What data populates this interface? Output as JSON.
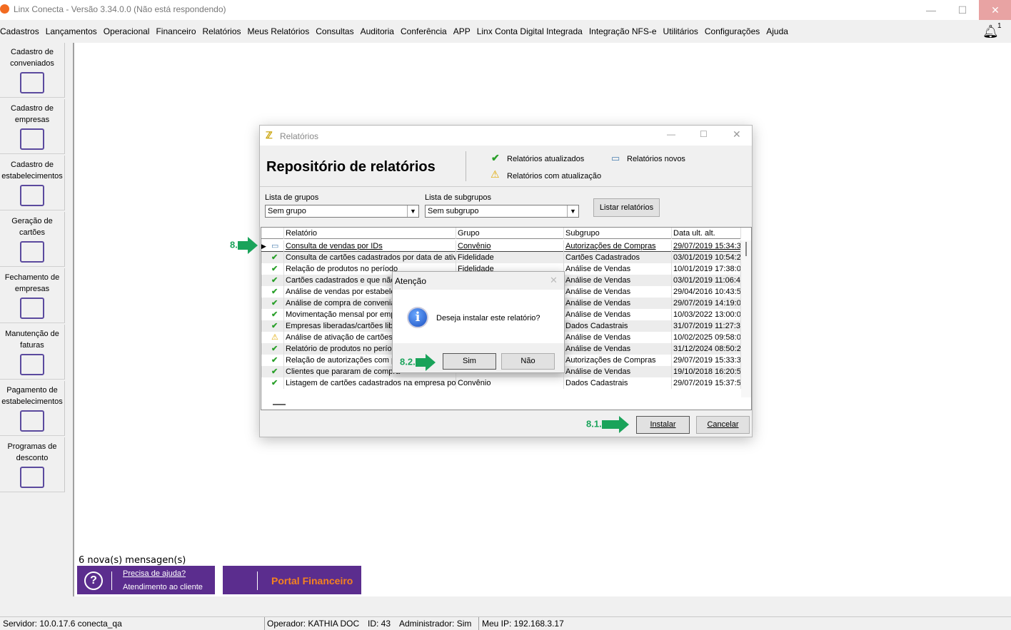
{
  "window": {
    "title": "Linx Conecta - Versão 3.34.0.0 (Não está respondendo)",
    "minimize": "—",
    "maximize": "☐",
    "close": "✕"
  },
  "menu": [
    "Cadastros",
    "Lançamentos",
    "Operacional",
    "Financeiro",
    "Relatórios",
    "Meus Relatórios",
    "Consultas",
    "Auditoria",
    "Conferência",
    "APP",
    "Linx Conta Digital Integrada",
    "Integração NFS-e",
    "Utilitários",
    "Configurações",
    "Ajuda"
  ],
  "notifications": {
    "count": "1"
  },
  "sidebar": [
    {
      "label": "Cadastro de conveniados",
      "icon": "user-icon"
    },
    {
      "label": "Cadastro de empresas",
      "icon": "building-icon"
    },
    {
      "label": "Cadastro de estabelecimentos",
      "icon": "store-icon"
    },
    {
      "label": "Geração de cartões",
      "icon": "card-icon"
    },
    {
      "label": "Fechamento de empresas",
      "icon": "invoice-icon"
    },
    {
      "label": "Manutenção de faturas",
      "icon": "tray-icon"
    },
    {
      "label": "Pagamento de estabelecimentos",
      "icon": "payment-icon"
    },
    {
      "label": "Programas de desconto",
      "icon": "discount-icon"
    }
  ],
  "messages": "6 nova(s) mensagen(s)",
  "help": {
    "link": "Precisa de ajuda?",
    "sub": "Atendimento ao cliente"
  },
  "portal": "Portal Financeiro",
  "status": {
    "server": "Servidor: 10.0.17.6 conecta_qa",
    "operator": "Operador: KATHIA DOC",
    "id": "ID: 43",
    "admin": "Administrador: Sim",
    "ip": "Meu IP: 192.168.3.17"
  },
  "dialog": {
    "title": "Relatórios",
    "heading": "Repositório de relatórios",
    "legend": {
      "updated": "Relatórios atualizados",
      "new": "Relatórios novos",
      "with_update": "Relatórios com atualização"
    },
    "groups_label": "Lista de grupos",
    "groups_value": "Sem grupo",
    "subgroups_label": "Lista de subgrupos",
    "subgroups_value": "Sem subgrupo",
    "list_button": "Listar relatórios",
    "install": "Instalar",
    "cancel": "Cancelar",
    "columns": [
      "Relatório",
      "Grupo",
      "Subgrupo",
      "Data ult. alt."
    ],
    "rows": [
      {
        "status": "new",
        "name": "Consulta de vendas por IDs",
        "group": "Convênio",
        "subgroup": "Autorizações de Compras",
        "date": "29/07/2019 15:34:3"
      },
      {
        "status": "ok",
        "name": "Consulta de cartões cadastrados por data de ativa",
        "group": "Fidelidade",
        "subgroup": "Cartões Cadastrados",
        "date": "03/01/2019 10:54:2"
      },
      {
        "status": "ok",
        "name": "Relação de produtos no período",
        "group": "Fidelidade",
        "subgroup": "Análise de Vendas",
        "date": "10/01/2019 17:38:0"
      },
      {
        "status": "ok",
        "name": "Cartões cadastrados e que não",
        "group": "",
        "subgroup": "Análise de Vendas",
        "date": "03/01/2019 11:06:4"
      },
      {
        "status": "ok",
        "name": "Análise de vendas por estabele",
        "group": "",
        "subgroup": "Análise de Vendas",
        "date": "29/04/2016 10:43:5"
      },
      {
        "status": "ok",
        "name": "Análise de compra de convenia",
        "group": "",
        "subgroup": "Análise de Vendas",
        "date": "29/07/2019 14:19:0"
      },
      {
        "status": "ok",
        "name": "Movimentação mensal por emp",
        "group": "",
        "subgroup": "Análise de Vendas",
        "date": "10/03/2022 13:00:0"
      },
      {
        "status": "ok",
        "name": "Empresas liberadas/cartões libe",
        "group": "",
        "subgroup": "Dados Cadastrais",
        "date": "31/07/2019 11:27:3"
      },
      {
        "status": "warn",
        "name": "Análise de ativação de cartões/",
        "group": "",
        "subgroup": "Análise de Vendas",
        "date": "10/02/2025 09:58:0"
      },
      {
        "status": "ok",
        "name": "Relatório de produtos no perío",
        "group": "",
        "subgroup": "Análise de Vendas",
        "date": "31/12/2024 08:50:2"
      },
      {
        "status": "ok",
        "name": "Relação de autorizações com p",
        "group": "",
        "subgroup": "Autorizações de Compras",
        "date": "29/07/2019 15:33:3"
      },
      {
        "status": "ok",
        "name": "Clientes que pararam de compra",
        "group": "",
        "subgroup": "Análise de Vendas",
        "date": "19/10/2018 16:20:5"
      },
      {
        "status": "ok",
        "name": "Listagem de cartões cadastrados na empresa por p",
        "group": "Convênio",
        "subgroup": "Dados Cadastrais",
        "date": "29/07/2019 15:37:5"
      }
    ]
  },
  "alert": {
    "title": "Atenção",
    "message": "Deseja instalar este relatório?",
    "yes": "Sim",
    "no": "Não"
  },
  "annotations": {
    "step8": "8.",
    "step81": "8.1.",
    "step82": "8.2."
  }
}
